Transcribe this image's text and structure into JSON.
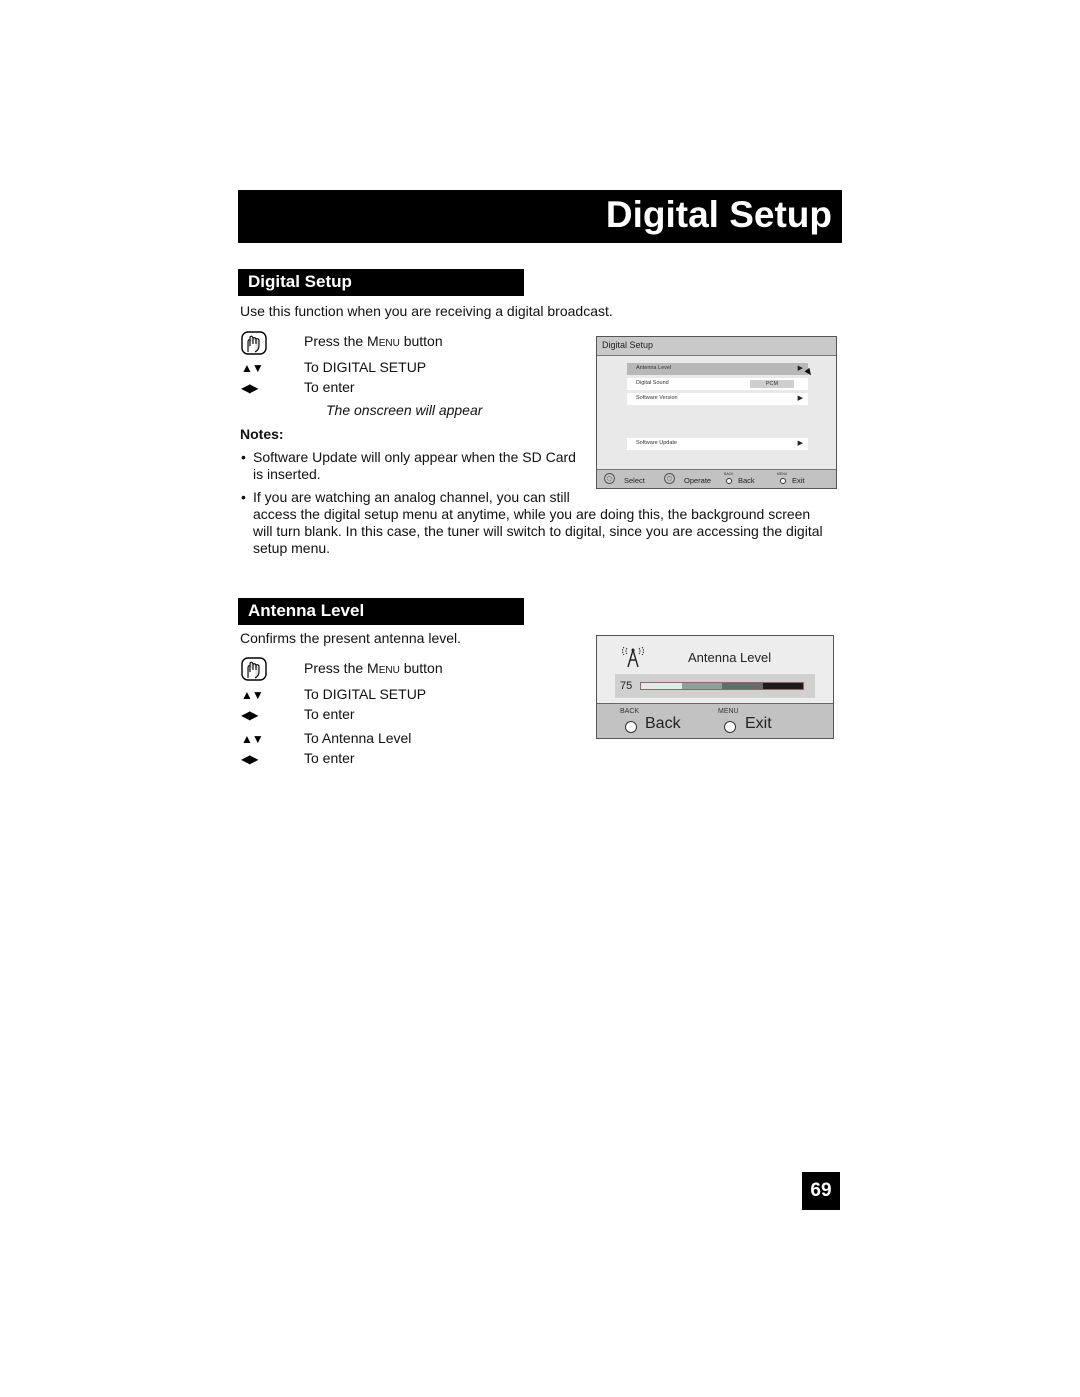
{
  "page_header": {
    "title": "Digital Setup"
  },
  "digital_setup": {
    "heading": "Digital Setup",
    "intro": "Use this function when you are receiving a digital broadcast.",
    "steps": [
      {
        "icon": "menu-button-hand-icon",
        "pre": "Press the ",
        "key": "Menu",
        "post": " button"
      },
      {
        "icon": "up-down-arrows-icon",
        "text": "To DIGITAL SETUP"
      },
      {
        "icon": "left-right-arrows-icon",
        "text": "To enter"
      }
    ],
    "onscreen_note": "The onscreen will appear",
    "notes_label": "Notes:",
    "notes": [
      {
        "line1": "Software Update will only appear when the SD Card",
        "line2": "is inserted."
      },
      {
        "line1": "If you are watching an analog channel, you can still",
        "line2": "access the digital setup menu at anytime, while you are doing this, the background screen",
        "line3": "will turn blank.  In this case, the tuner will switch to digital, since you are accessing the digital",
        "line4": "setup menu."
      }
    ],
    "osd": {
      "title": "Digital Setup",
      "items": [
        {
          "label": "Antenna Level",
          "has_arrow": true,
          "selected": true
        },
        {
          "label": "Digital Sound",
          "value": "PCM"
        },
        {
          "label": "Software Version",
          "has_arrow": true
        },
        {
          "label": "Software Update",
          "has_arrow": true
        }
      ],
      "footer": {
        "select": "Select",
        "operate": "Operate",
        "back_key": "BACK",
        "back": "Back",
        "menu_key": "MENU",
        "exit": "Exit"
      }
    }
  },
  "antenna_level": {
    "heading": "Antenna Level",
    "intro": "Confirms the present antenna level.",
    "steps": [
      {
        "icon": "menu-button-hand-icon",
        "pre": "Press the ",
        "key": "Menu",
        "post": " button"
      },
      {
        "icon": "up-down-arrows-icon",
        "text": "To DIGITAL SETUP"
      },
      {
        "icon": "left-right-arrows-icon",
        "text": "To enter"
      },
      {
        "icon": "up-down-arrows-icon",
        "text": "To Antenna Level"
      },
      {
        "icon": "left-right-arrows-icon",
        "text": "To enter"
      }
    ],
    "osd": {
      "title": "Antenna Level",
      "level": "75",
      "segment_colors": [
        "#e8e8e8",
        "#9a9a9a",
        "#6a6a6a",
        "#1e1a1a"
      ],
      "footer": {
        "back_key": "BACK",
        "back": "Back",
        "menu_key": "MENU",
        "exit": "Exit"
      }
    }
  },
  "page_number": "69"
}
